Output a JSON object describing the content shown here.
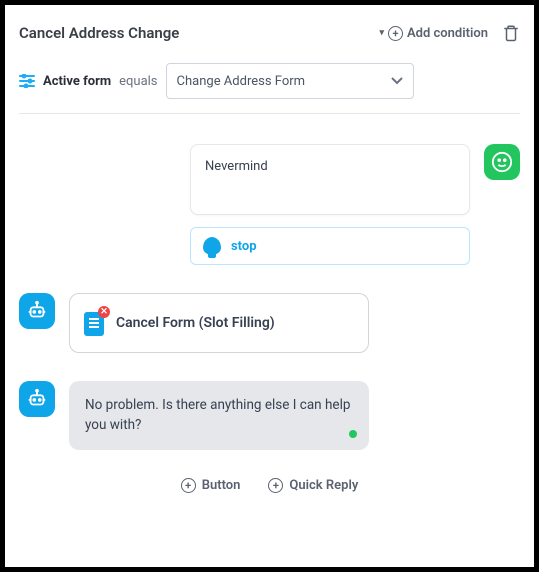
{
  "header": {
    "title": "Cancel Address Change",
    "add_condition": "Add condition"
  },
  "condition": {
    "field": "Active form",
    "operator": "equals",
    "value": "Change Address Form"
  },
  "user_message": {
    "text": "Nevermind",
    "intent": "stop"
  },
  "bot_action": {
    "label": "Cancel Form (Slot Filling)"
  },
  "bot_reply": {
    "text": "No problem. Is there anything else I can help you with?"
  },
  "footer": {
    "button_label": "Button",
    "quick_reply_label": "Quick Reply"
  }
}
